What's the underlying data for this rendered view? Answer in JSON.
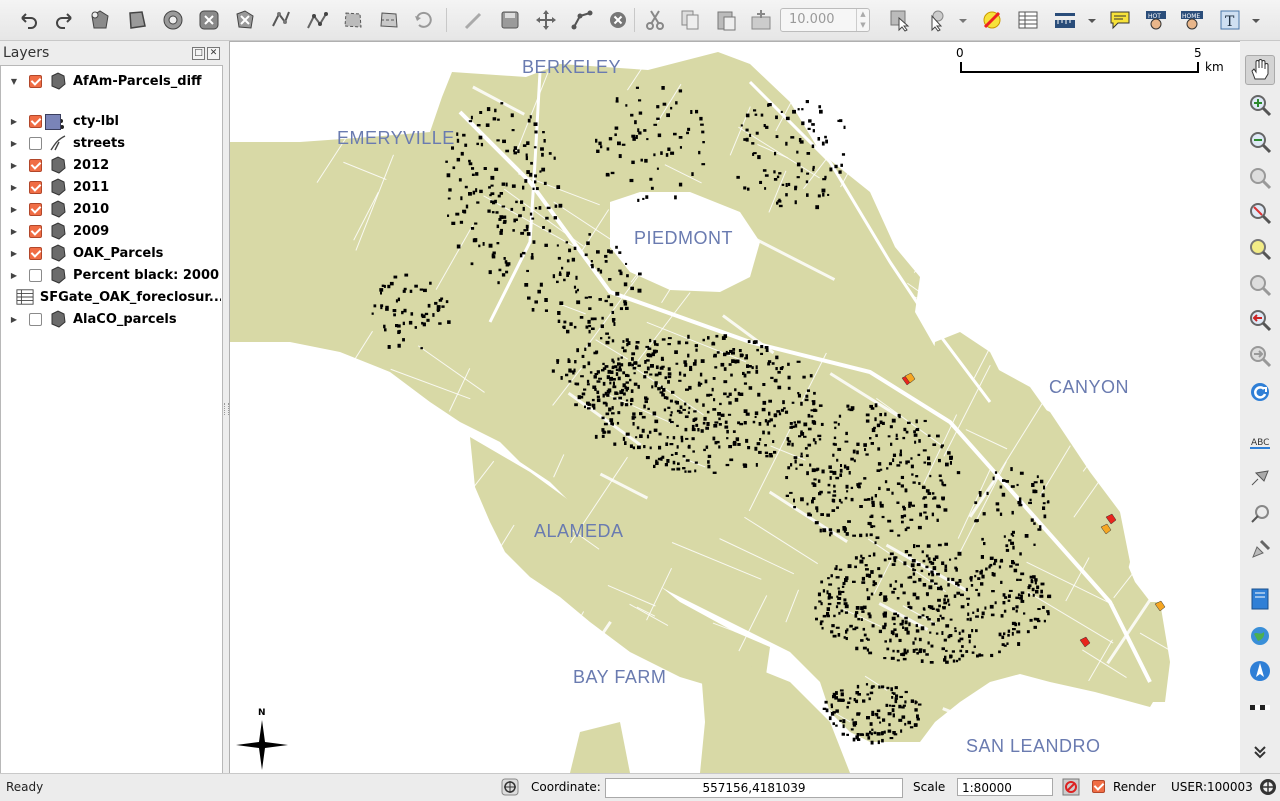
{
  "toolbar": {
    "zoom_value": "10.000",
    "tools": [
      "undo-icon",
      "redo-icon",
      "add-ring-icon",
      "add-part-icon",
      "fill-ring-icon",
      "delete-ring-icon",
      "delete-part-icon",
      "reshape-icon",
      "offset-curve-icon",
      "split-features-icon",
      "split-parts-icon",
      "merge-icon",
      "rotate-icon",
      "simplify-icon",
      "digitize-icon",
      "save-edits-icon",
      "move-feature-icon",
      "node-tool-icon",
      "delete-selected-icon",
      "cut-icon",
      "copy-icon",
      "paste-icon",
      "zoom-full-edit-icon",
      "identify-icon",
      "select-icon",
      "deselect-icon",
      "attribute-table-icon",
      "measure-icon",
      "map-tips-icon",
      "hotlink-icon",
      "home-icon",
      "text-annotation-icon"
    ]
  },
  "layers_panel": {
    "title": "Layers",
    "layers": [
      {
        "name": "AfAm-Parcels_diff",
        "checked": true,
        "expanded": true,
        "icon": "polygon-layer-icon"
      },
      {
        "name": "cty-lbl",
        "checked": true,
        "expanded": false,
        "icon": "point-layer-icon"
      },
      {
        "name": "streets",
        "checked": false,
        "expanded": false,
        "icon": "line-layer-icon"
      },
      {
        "name": "2012",
        "checked": true,
        "expanded": false,
        "icon": "polygon-layer-icon"
      },
      {
        "name": "2011",
        "checked": true,
        "expanded": false,
        "icon": "polygon-layer-icon"
      },
      {
        "name": "2010",
        "checked": true,
        "expanded": false,
        "icon": "polygon-layer-icon"
      },
      {
        "name": "2009",
        "checked": true,
        "expanded": false,
        "icon": "polygon-layer-icon"
      },
      {
        "name": "OAK_Parcels",
        "checked": true,
        "expanded": false,
        "icon": "polygon-layer-icon"
      },
      {
        "name": "Percent black: 2000",
        "checked": false,
        "expanded": false,
        "icon": "polygon-layer-icon"
      },
      {
        "name": "SFGate_OAK_foreclosur...",
        "checked": null,
        "expanded": null,
        "icon": "table-layer-icon"
      },
      {
        "name": "AlaCO_parcels",
        "checked": false,
        "expanded": false,
        "icon": "polygon-layer-icon"
      }
    ],
    "legend_swatch_color": "#7a84b8"
  },
  "map": {
    "land_color": "#d8d9a6",
    "water_color": "#ffffff",
    "parcel_color": "#000000",
    "highlight_colors": [
      "#e8251c",
      "#f5a623"
    ],
    "labels": [
      "BERKELEY",
      "EMERYVILLE",
      "PIEDMONT",
      "CANYON",
      "ALAMEDA",
      "BAY FARM",
      "SAN LEANDRO"
    ],
    "scalebar": {
      "start": "0",
      "end": "5",
      "unit": "km"
    },
    "north_label": "N"
  },
  "statusbar": {
    "status": "Ready",
    "coordinate_label": "Coordinate:",
    "coordinate_value": "557156,4181039",
    "scale_label": "Scale",
    "scale_value": "1:80000",
    "render_label": "Render",
    "render_checked": true,
    "crs_label": "USER:100003"
  }
}
